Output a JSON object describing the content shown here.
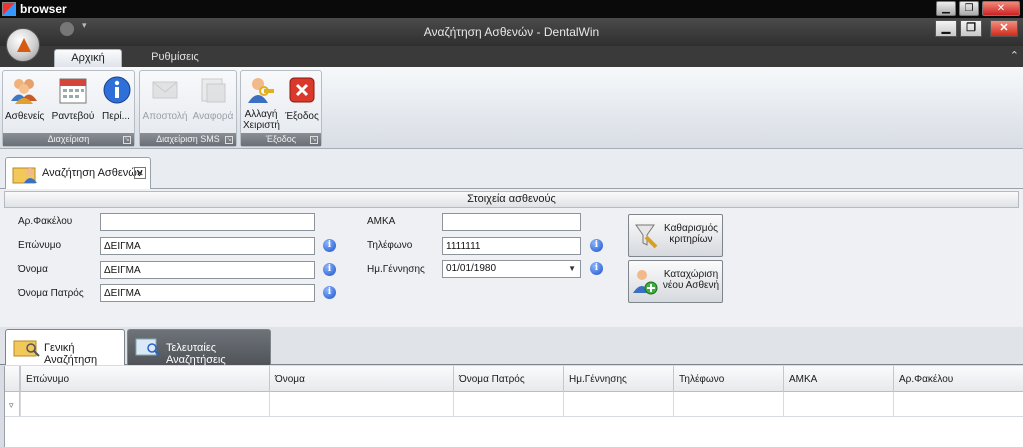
{
  "host": {
    "title": "browser",
    "buttons": {
      "minimize": "▁",
      "restore": "❐",
      "close": "✕"
    }
  },
  "app": {
    "title": "Αναζήτηση Ασθενών - DentalWin",
    "buttons": {
      "minimize": "▁",
      "restore": "❐",
      "close": "✕"
    },
    "quick_access": "▾"
  },
  "ribbon": {
    "tabs": [
      {
        "label": "Αρχική",
        "active": true
      },
      {
        "label": "Ρυθμίσεις",
        "active": false
      }
    ],
    "collapse_glyph": "⌃",
    "groups": [
      {
        "label": "Διαχείριση",
        "buttons": [
          {
            "label": "Ασθενείς",
            "icon": "patients-icon",
            "enabled": true
          },
          {
            "label": "Ραντεβού",
            "icon": "calendar-icon",
            "enabled": true
          },
          {
            "label": "Περί...",
            "icon": "info-icon",
            "enabled": true
          }
        ]
      },
      {
        "label": "Διαχείριση SMS",
        "buttons": [
          {
            "label": "Αποστολή",
            "icon": "sms-send-icon",
            "enabled": false
          },
          {
            "label": "Αναφορά",
            "icon": "sms-report-icon",
            "enabled": false
          }
        ]
      },
      {
        "label": "Έξοδος",
        "buttons": [
          {
            "label_line1": "Αλλαγή",
            "label_line2": "Χειριστή",
            "icon": "change-user-icon",
            "enabled": true
          },
          {
            "label": "Έξοδος",
            "icon": "exit-icon",
            "enabled": true
          }
        ]
      }
    ]
  },
  "document_tab": {
    "label": "Αναζήτηση Ασθενών",
    "close": "✕"
  },
  "form": {
    "header": "Στοιχεία ασθενούς",
    "fields": {
      "folder_no": {
        "label": "Αρ.Φακέλου",
        "value": ""
      },
      "surname": {
        "label": "Επώνυμο",
        "value": "ΔΕΙΓΜΑ"
      },
      "name": {
        "label": "Όνομα",
        "value": "ΔΕΙΓΜΑ"
      },
      "father_name": {
        "label": "Όνομα Πατρός",
        "value": "ΔΕΙΓΜΑ"
      },
      "amka": {
        "label": "ΑΜΚΑ",
        "value": ""
      },
      "phone": {
        "label": "Τηλέφωνο",
        "value": "1111111"
      },
      "birth_date": {
        "label": "Ημ.Γέννησης",
        "value": "01/01/1980"
      }
    },
    "info_glyph": "i",
    "buttons": {
      "clear_line1": "Καθαρισμός",
      "clear_line2": "κριτηρίων",
      "new_line1": "Καταχώριση",
      "new_line2": "νέου Ασθενή"
    }
  },
  "search_tabs": [
    {
      "label": "Γενική Αναζήτηση",
      "active": true
    },
    {
      "label": "Τελευταίες Αναζητήσεις",
      "active": false
    }
  ],
  "grid": {
    "columns": [
      "Επώνυμο",
      "Όνομα",
      "Όνομα Πατρός",
      "Ημ.Γέννησης",
      "Τηλέφωνο",
      "ΑΜΚΑ",
      "Αρ.Φακέλου"
    ],
    "filter_glyph": "▿"
  },
  "colors": {
    "accent_blue": "#1d52c8",
    "exit_red": "#d02a1a",
    "orb_orange": "#d65a10"
  }
}
